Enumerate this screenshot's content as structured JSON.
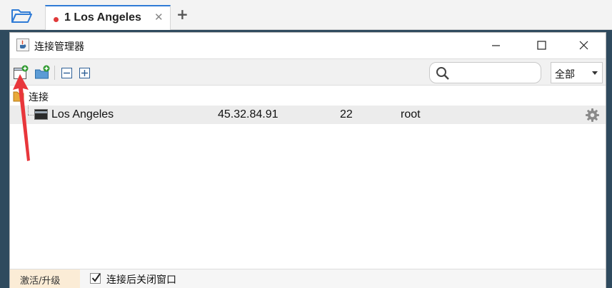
{
  "tabs": [
    {
      "label": "1 Los Angeles",
      "status_color": "#e03a3a"
    }
  ],
  "dialog": {
    "title": "连接管理器",
    "search": {
      "value": "",
      "placeholder": ""
    },
    "filter": {
      "selected": "全部"
    }
  },
  "tree": {
    "group_label": "连接",
    "connections": [
      {
        "name": "Los Angeles",
        "host": "45.32.84.91",
        "port": "22",
        "user": "root"
      }
    ]
  },
  "statusbar": {
    "activate_label": "激活/升级",
    "close_after_connect_label": "连接后关闭窗口",
    "close_after_connect_checked": true
  },
  "colors": {
    "accent": "#2f7bd6",
    "annotation_arrow": "#e8363b",
    "status_dot": "#e03a3a"
  },
  "icons": [
    "folder-open-icon",
    "close-icon",
    "plus-icon",
    "app-java-icon",
    "minimize-icon",
    "maximize-icon",
    "close-icon",
    "new-session-icon",
    "new-folder-icon",
    "collapse-all-icon",
    "expand-all-icon",
    "search-icon",
    "folder-group-icon",
    "terminal-icon",
    "gear-icon",
    "checkbox-check-icon"
  ]
}
